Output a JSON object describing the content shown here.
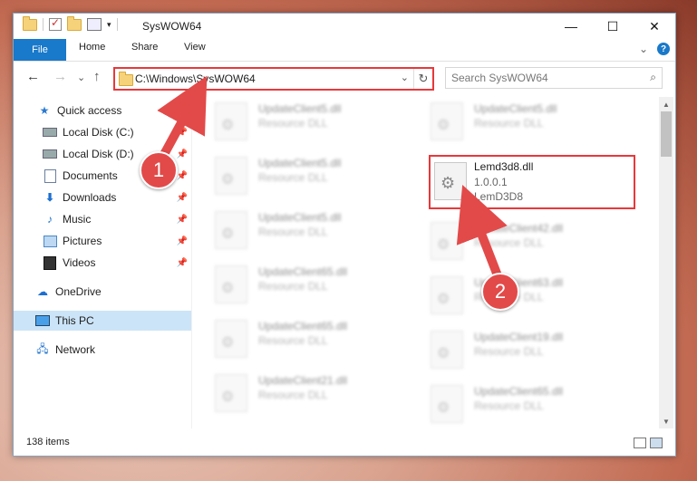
{
  "window": {
    "title": "SysWOW64",
    "controls": {
      "minimize": "—",
      "maximize": "☐",
      "close": "✕"
    }
  },
  "ribbon": {
    "tabs": [
      "File",
      "Home",
      "Share",
      "View"
    ],
    "expand": "⌄",
    "help": "?"
  },
  "nav": {
    "back": "←",
    "forward": "→",
    "recent": "⌄",
    "up": "↑",
    "address": "C:\\Windows\\SysWOW64",
    "address_dropdown": "⌄",
    "refresh": "↻",
    "search_placeholder": "Search SysWOW64",
    "search_icon": "⌕"
  },
  "sidebar": {
    "items": [
      {
        "label": "Quick access",
        "icon": "star-icon"
      },
      {
        "label": "Local Disk (C:)",
        "icon": "drive-icon",
        "pinned": true
      },
      {
        "label": "Local Disk (D:)",
        "icon": "drive-icon",
        "pinned": true
      },
      {
        "label": "Documents",
        "icon": "documents-icon",
        "pinned": true
      },
      {
        "label": "Downloads",
        "icon": "downloads-icon",
        "pinned": true
      },
      {
        "label": "Music",
        "icon": "music-icon",
        "pinned": true
      },
      {
        "label": "Pictures",
        "icon": "pictures-icon",
        "pinned": true
      },
      {
        "label": "Videos",
        "icon": "videos-icon",
        "pinned": true
      },
      {
        "label": "OneDrive",
        "icon": "onedrive-icon"
      },
      {
        "label": "This PC",
        "icon": "this-pc-icon",
        "selected": true
      },
      {
        "label": "Network",
        "icon": "network-icon"
      }
    ],
    "pin_glyph": "📌"
  },
  "files": {
    "left_column": [
      {
        "name": "UpdateClient5.dll",
        "type": "Resource DLL"
      },
      {
        "name": "UpdateClient5.dll",
        "type": "Resource DLL"
      },
      {
        "name": "UpdateClient5.dll",
        "type": "Resource DLL"
      },
      {
        "name": "UpdateClient65.dll",
        "type": "Resource DLL"
      },
      {
        "name": "UpdateClient65.dll",
        "type": "Resource DLL"
      },
      {
        "name": "UpdateClient21.dll",
        "type": "Resource DLL"
      }
    ],
    "right_column": [
      {
        "name": "UpdateClient5.dll",
        "type": "Resource DLL"
      },
      {
        "name": "UpdateClient42.dll",
        "type": "Resource DLL"
      },
      {
        "name": "UpdateClient63.dll",
        "type": "Resource DLL"
      },
      {
        "name": "UpdateClient19.dll",
        "type": "Resource DLL"
      },
      {
        "name": "UpdateClient65.dll",
        "type": "Resource DLL"
      }
    ],
    "highlighted": {
      "name": "Lemd3d8.dll",
      "version": "1.0.0.1",
      "description": "LemD3D8"
    }
  },
  "status": {
    "item_count": "138 items"
  },
  "annotations": {
    "step1": "1",
    "step2": "2",
    "color": "#e24a49"
  }
}
